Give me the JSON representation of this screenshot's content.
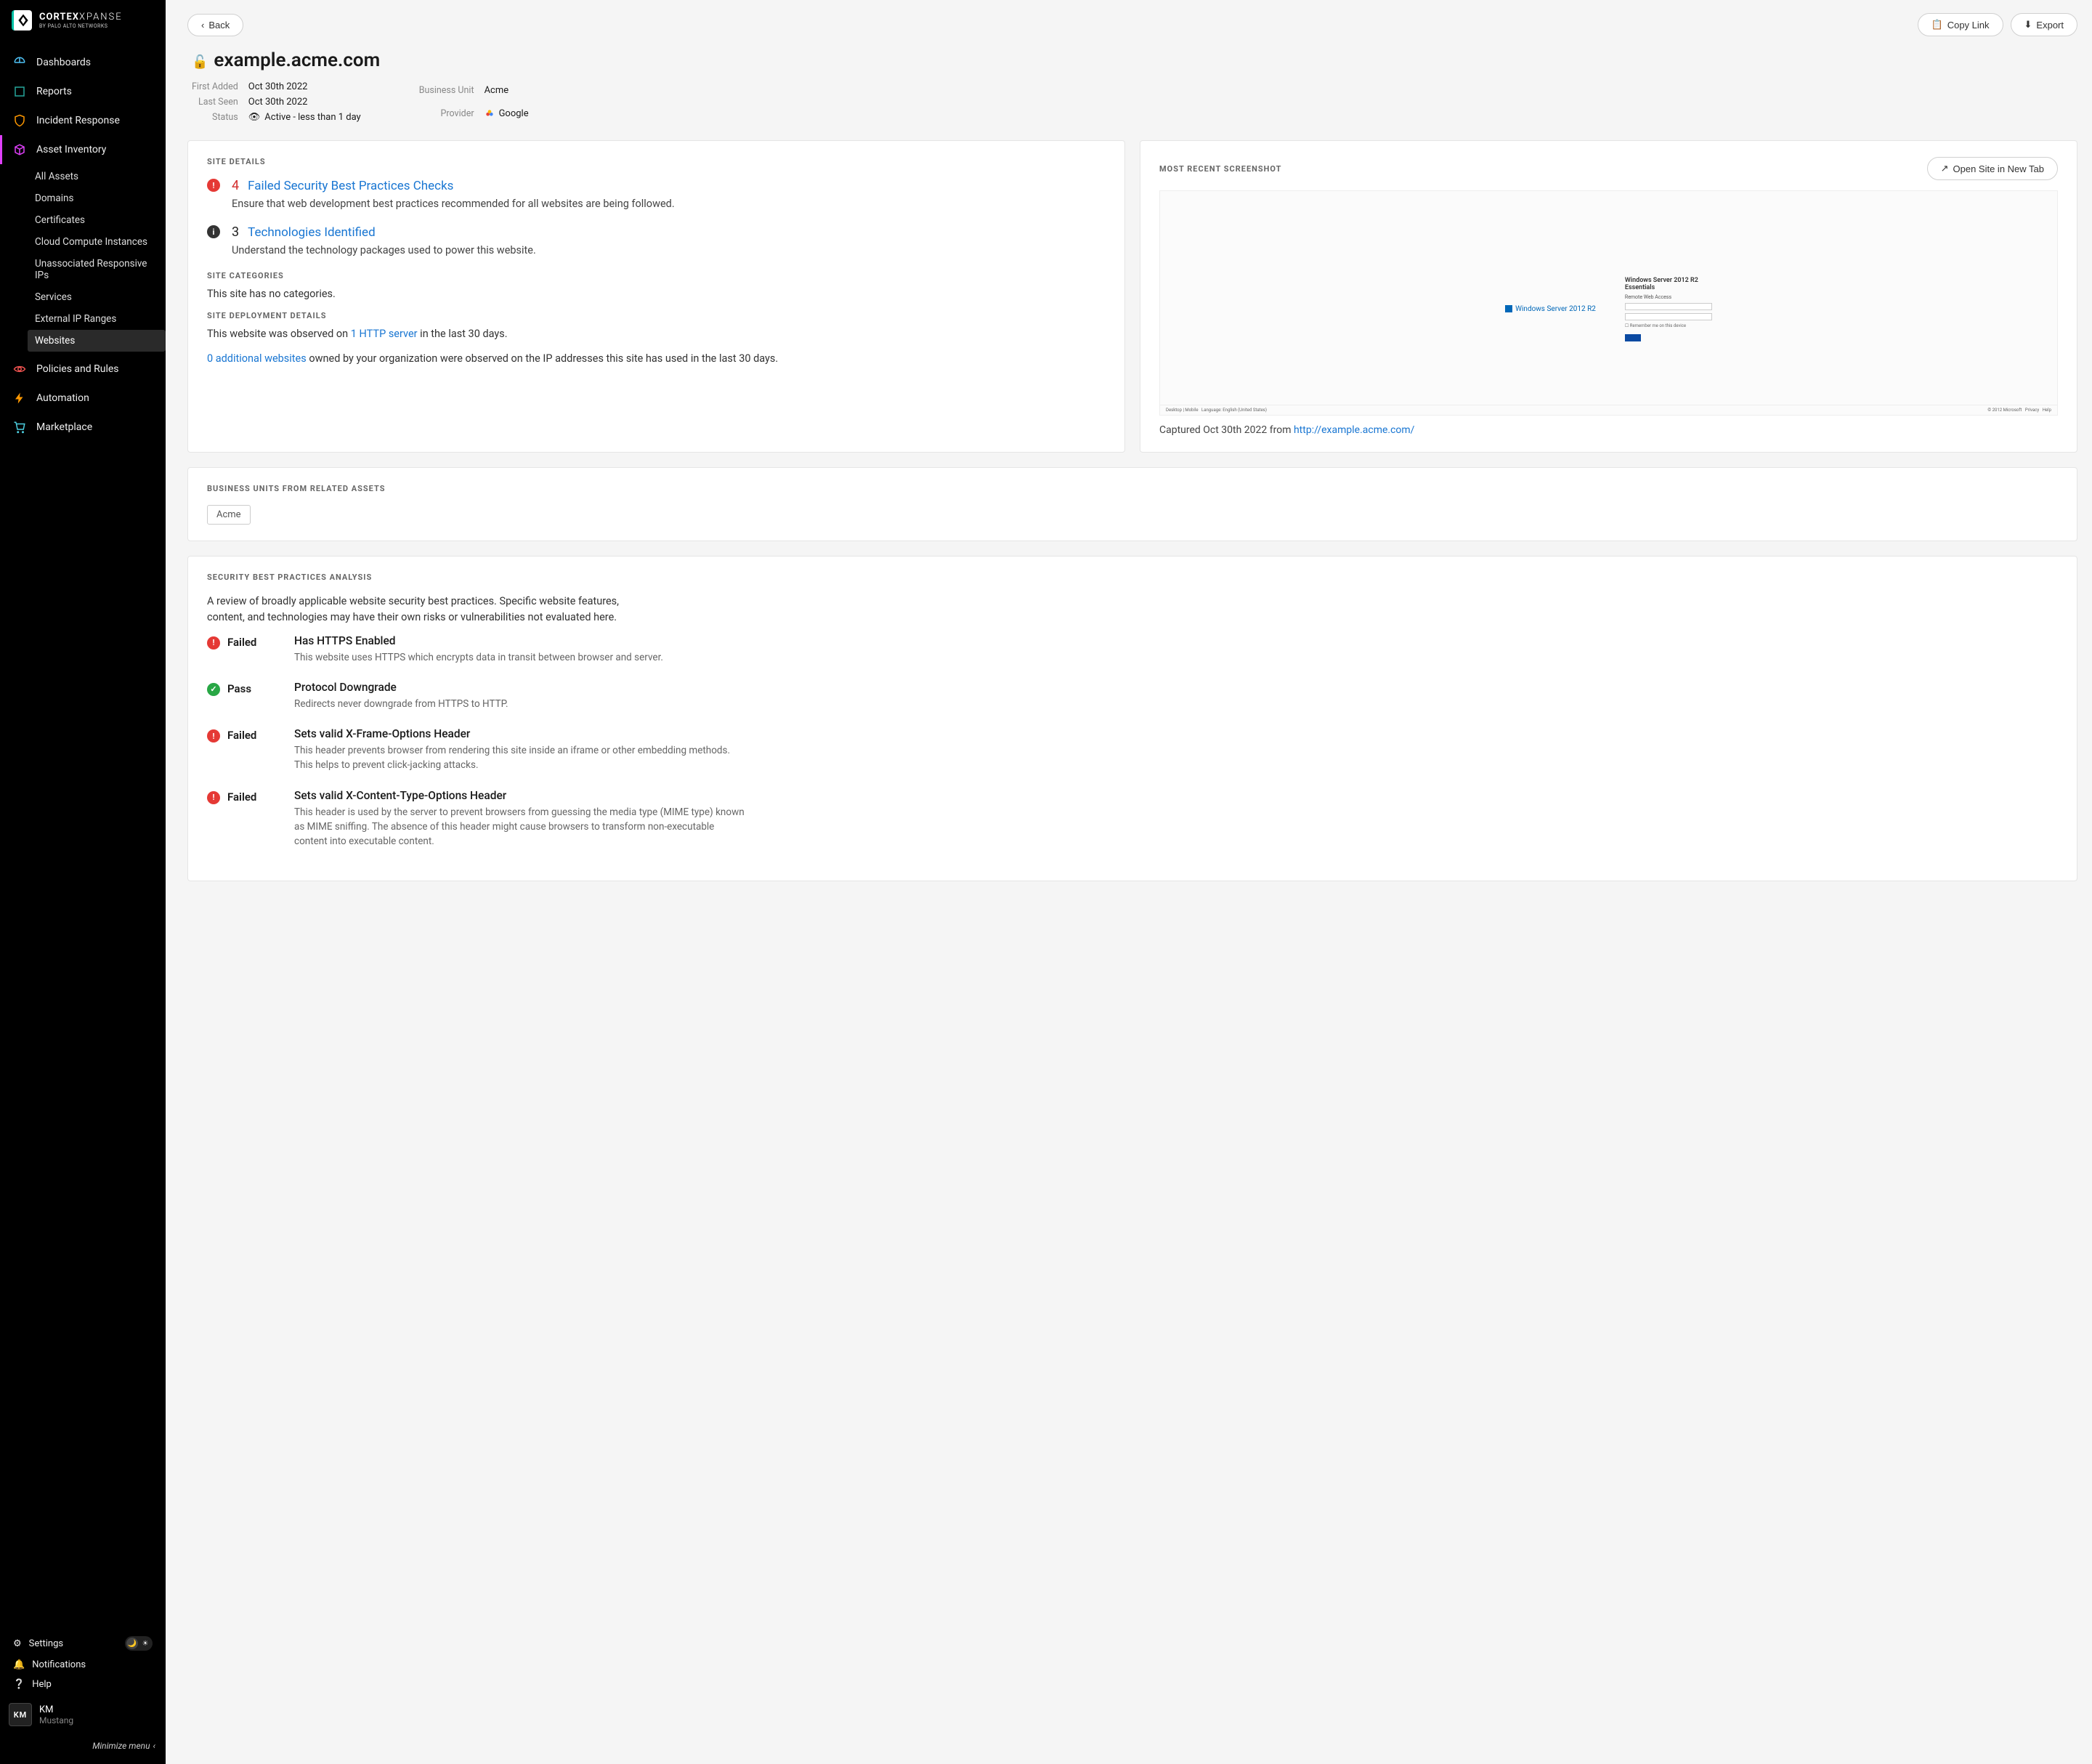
{
  "brand": {
    "title_bold": "CORTEX",
    "title_light": "XPANSE",
    "subtitle": "BY PALO ALTO NETWORKS"
  },
  "nav": {
    "dashboards": "Dashboards",
    "reports": "Reports",
    "incident": "Incident Response",
    "inventory": "Asset Inventory",
    "inventory_items": [
      "All Assets",
      "Domains",
      "Certificates",
      "Cloud Compute Instances",
      "Unassociated Responsive IPs",
      "Services",
      "External IP Ranges",
      "Websites"
    ],
    "policies": "Policies and Rules",
    "automation": "Automation",
    "marketplace": "Marketplace"
  },
  "sidebar_bottom": {
    "settings": "Settings",
    "notifications": "Notifications",
    "help": "Help"
  },
  "user": {
    "initials": "KM",
    "name": "KM",
    "org": "Mustang"
  },
  "minimize": "Minimize menu",
  "topbar": {
    "back": "Back",
    "copy": "Copy Link",
    "export": "Export"
  },
  "page": {
    "title": "example.acme.com"
  },
  "meta": {
    "first_added_label": "First Added",
    "first_added": "Oct 30th 2022",
    "last_seen_label": "Last Seen",
    "last_seen": "Oct 30th 2022",
    "status_label": "Status",
    "status": "Active - less than 1 day",
    "bu_label": "Business Unit",
    "bu": "Acme",
    "provider_label": "Provider",
    "provider": "Google"
  },
  "site_details": {
    "title": "SITE DETAILS",
    "checks_count": "4",
    "checks_link": "Failed Security Best Practices Checks",
    "checks_desc": "Ensure that web development best practices recommended for all websites are being followed.",
    "tech_count": "3",
    "tech_link": "Technologies Identified",
    "tech_desc": "Understand the technology packages used to power this website.",
    "categories_title": "SITE CATEGORIES",
    "categories_text": "This site has no categories.",
    "deploy_title": "SITE DEPLOYMENT DETAILS",
    "deploy_pre": "This website was observed on ",
    "deploy_link": "1 HTTP server",
    "deploy_post": " in the last 30 days.",
    "add_link": "0 additional websites",
    "add_post": " owned by your organization were observed on the IP addresses this site has used in the last 30 days."
  },
  "screenshot": {
    "title": "MOST RECENT SCREENSHOT",
    "open": "Open Site in New Tab",
    "ss_winlabel": "Windows Server 2012 R2",
    "ss_heading": "Windows Server 2012 R2 Essentials",
    "ss_sub": "Remote Web Access",
    "caption_pre": "Captured Oct 30th 2022 from ",
    "caption_link": "http://example.acme.com/"
  },
  "bu_card": {
    "title": "BUSINESS UNITS FROM RELATED ASSETS",
    "tag": "Acme"
  },
  "analysis": {
    "title": "SECURITY BEST PRACTICES ANALYSIS",
    "intro": "A review of broadly applicable website security best practices. Specific website features, content, and technologies may have their own risks or vulnerabilities not evaluated here.",
    "items": [
      {
        "status": "Failed",
        "pass": false,
        "title": "Has HTTPS Enabled",
        "desc": "This website uses HTTPS which encrypts data in transit between browser and server."
      },
      {
        "status": "Pass",
        "pass": true,
        "title": "Protocol Downgrade",
        "desc": "Redirects never downgrade from HTTPS to HTTP."
      },
      {
        "status": "Failed",
        "pass": false,
        "title": "Sets valid X-Frame-Options Header",
        "desc": "This header prevents browser from rendering this site inside an iframe or other embedding methods. This helps to prevent click-jacking attacks."
      },
      {
        "status": "Failed",
        "pass": false,
        "title": "Sets valid X-Content-Type-Options Header",
        "desc": "This header is used by the server to prevent browsers from guessing the media type (MIME type) known as MIME sniffing. The absence of this header might cause browsers to transform non-executable content into executable content."
      }
    ]
  }
}
